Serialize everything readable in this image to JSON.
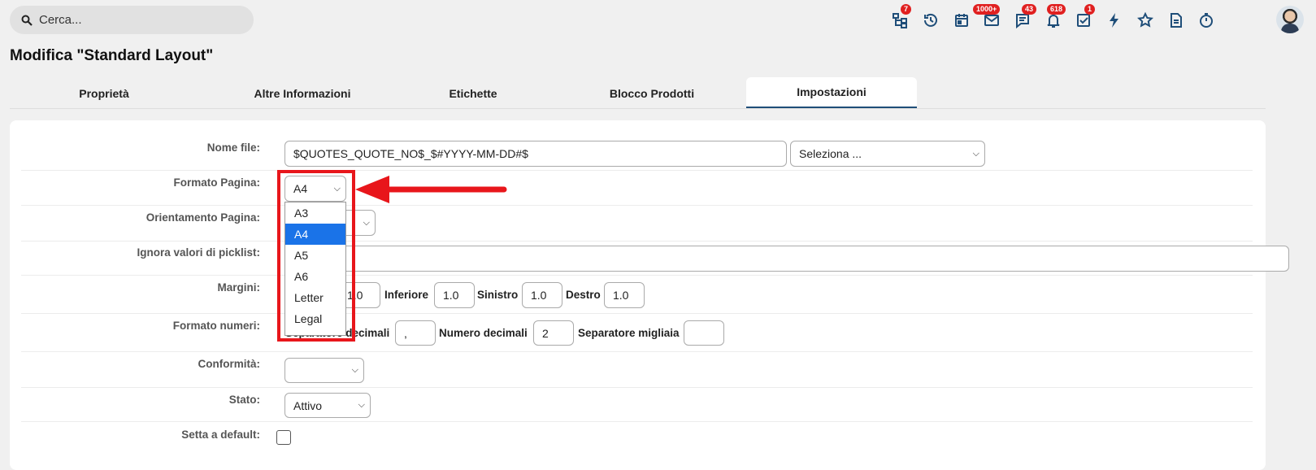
{
  "search": {
    "placeholder": "Cerca..."
  },
  "topbar": {
    "badges": {
      "tree": "7",
      "mail": "1000+",
      "chat": "43",
      "bell": "618",
      "tasks": "1"
    }
  },
  "page": {
    "title": "Modifica \"Standard Layout\""
  },
  "tabs": [
    "Proprietà",
    "Altre Informazioni",
    "Etichette",
    "Blocco Prodotti",
    "Impostazioni"
  ],
  "form": {
    "nome_file": {
      "label": "Nome file:",
      "value": "$QUOTES_QUOTE_NO$_$#YYYY-MM-DD#$",
      "select": "Seleziona ..."
    },
    "formato_pagina": {
      "label": "Formato Pagina:",
      "value": "A4"
    },
    "orientamento": {
      "label": "Orientamento Pagina:"
    },
    "ignora": {
      "label": "Ignora valori di picklist:"
    },
    "margini": {
      "label": "Margini:",
      "superiore_value": "1.0",
      "inferiore_label": "Inferiore",
      "inferiore_value": "1.0",
      "sinistro_label": "Sinistro",
      "sinistro_value": "1.0",
      "destro_label": "Destro",
      "destro_value": "1.0"
    },
    "formato_numeri": {
      "label": "Formato numeri:",
      "sep_dec_label": "Separatore decimali",
      "sep_dec_value": ",",
      "num_dec_label": "Numero decimali",
      "num_dec_value": "2",
      "sep_mig_label": "Separatore migliaia",
      "sep_mig_value": ""
    },
    "conformita": {
      "label": "Conformità:",
      "value": ""
    },
    "stato": {
      "label": "Stato:",
      "value": "Attivo"
    },
    "default": {
      "label": "Setta a default:"
    }
  },
  "dropdown": {
    "options": [
      "A3",
      "A4",
      "A5",
      "A6",
      "Letter",
      "Legal"
    ],
    "highlighted": "A4"
  },
  "colors": {
    "accent": "#1f4e79",
    "highlight": "#1a73e8",
    "annotation": "#e8161b",
    "badge": "#e02020"
  }
}
